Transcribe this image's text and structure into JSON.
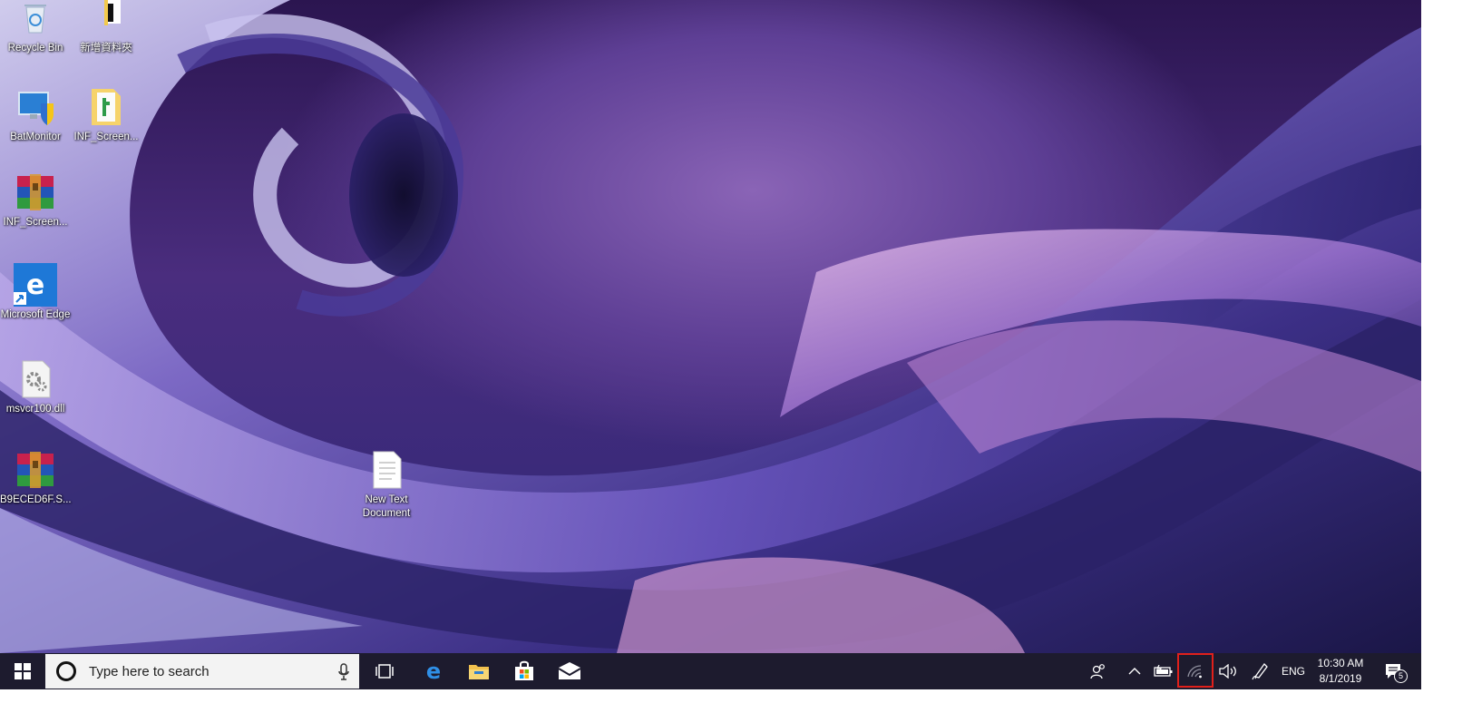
{
  "desktop": {
    "icons": [
      {
        "label": "Recycle Bin",
        "icon": "recycle-bin-icon"
      },
      {
        "label": "新增資料夾",
        "icon": "folder-icon"
      },
      {
        "label": "BatMonitor",
        "icon": "monitor-shield-icon"
      },
      {
        "label": "INF_Screen...",
        "icon": "zip-folder-icon"
      },
      {
        "label": "INF_Screen...",
        "icon": "winrar-archive-icon"
      },
      {
        "label": "Microsoft Edge",
        "icon": "edge-shortcut-icon"
      },
      {
        "label": "msvcr100.dll",
        "icon": "dll-file-icon"
      },
      {
        "label": "B9ECED6F.S...",
        "icon": "winrar-archive-icon"
      },
      {
        "label": "New Text Document",
        "icon": "text-document-icon"
      }
    ]
  },
  "taskbar": {
    "search": {
      "placeholder": "Type here to search"
    },
    "pinned": [
      "task-view-icon",
      "edge-icon",
      "file-explorer-icon",
      "store-icon",
      "mail-icon"
    ],
    "tray": {
      "language": "ENG",
      "time": "10:30 AM",
      "date": "8/1/2019",
      "notification_count": "5"
    }
  },
  "colors": {
    "taskbar": "#1d1b2e",
    "highlight": "#e0201b",
    "search_box": "#f3f3f3"
  }
}
